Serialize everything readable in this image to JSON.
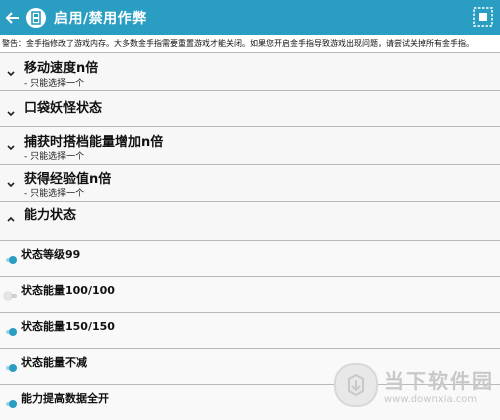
{
  "appbar": {
    "title": "启用/禁用作弊",
    "back_icon": "back-arrow-icon",
    "logo_icon": "game-cartridge-icon",
    "action_icon": "select-all-icon",
    "color": "#2a9ec2"
  },
  "warning": "警告：金手指修改了游戏内存。大多数金手指需要重置游戏才能关闭。如果您开启金手指导致游戏出现问题，请尝试关掉所有金手指。",
  "groups": [
    {
      "title": "移动速度n倍",
      "subtitle": "- 只能选择一个",
      "expanded": false
    },
    {
      "title": "口袋妖怪状态",
      "subtitle": "",
      "expanded": false
    },
    {
      "title": "捕获时搭档能量增加n倍",
      "subtitle": "- 只能选择一个",
      "expanded": false
    },
    {
      "title": "获得经验值n倍",
      "subtitle": "- 只能选择一个",
      "expanded": false
    },
    {
      "title": "能力状态",
      "subtitle": "",
      "expanded": true
    }
  ],
  "options": [
    {
      "label": "状态等级99",
      "enabled": true
    },
    {
      "label": "状态能量100/100",
      "enabled": false
    },
    {
      "label": "状态能量150/150",
      "enabled": true
    },
    {
      "label": "状态能量不减",
      "enabled": true
    },
    {
      "label": "能力提高数据全开",
      "enabled": true
    }
  ],
  "watermark": {
    "name": "当下软件园",
    "url": "www.downxia.com"
  }
}
